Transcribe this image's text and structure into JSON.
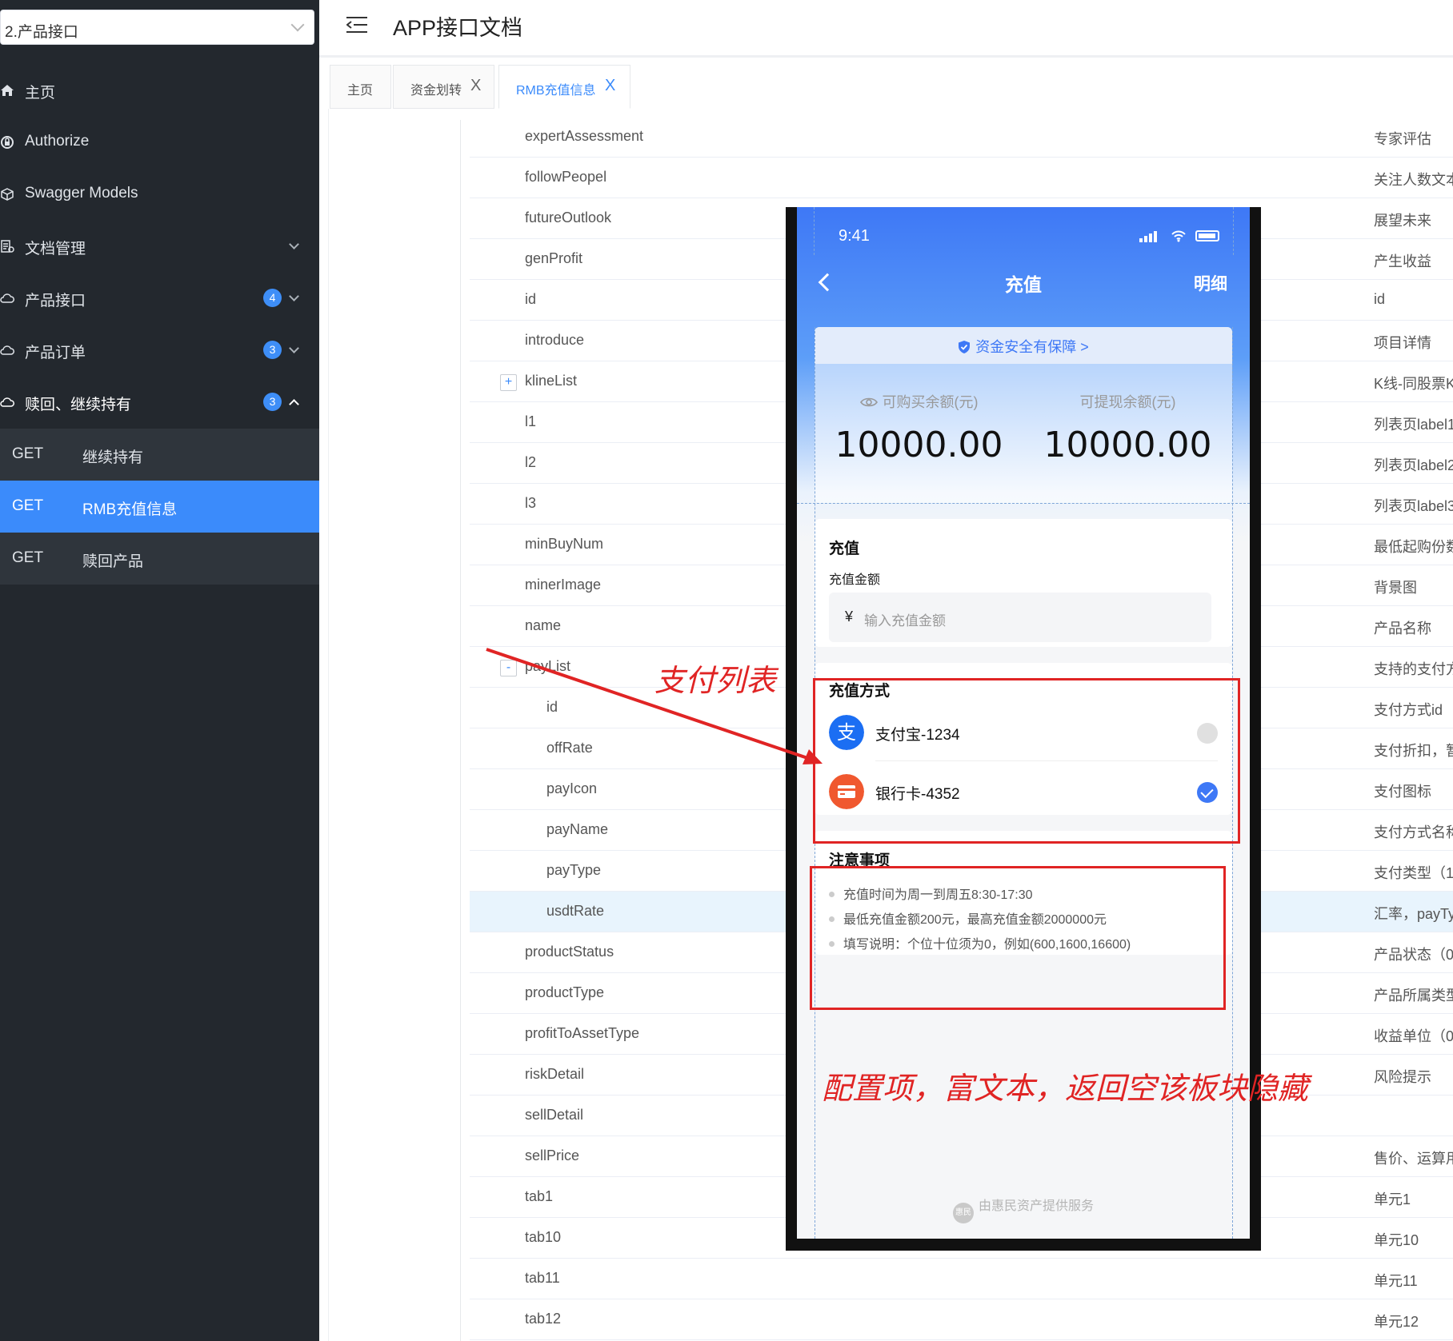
{
  "sidebar": {
    "project_select": "2.产品接口",
    "menu": [
      {
        "label": "主页"
      },
      {
        "label": "Authorize"
      },
      {
        "label": "Swagger Models"
      },
      {
        "label": "文档管理"
      },
      {
        "label": "产品接口",
        "badge": "4"
      },
      {
        "label": "产品订单",
        "badge": "3"
      },
      {
        "label": "赎回、继续持有",
        "badge": "3"
      }
    ],
    "submenu": [
      {
        "method": "GET",
        "name": "继续持有"
      },
      {
        "method": "GET",
        "name": "RMB充值信息"
      },
      {
        "method": "GET",
        "name": "赎回产品"
      }
    ]
  },
  "header": {
    "title": "APP接口文档"
  },
  "tabs": [
    {
      "label": "主页"
    },
    {
      "label": "资金划转",
      "close": "X"
    },
    {
      "label": "RMB充值信息",
      "close": "X"
    }
  ],
  "fields": [
    {
      "name": "expertAssessment",
      "desc": "专家评估"
    },
    {
      "name": "followPeopel",
      "desc": "关注人数文本"
    },
    {
      "name": "futureOutlook",
      "desc": "展望未来"
    },
    {
      "name": "genProfit",
      "desc": "产生收益"
    },
    {
      "name": "id",
      "desc": "id"
    },
    {
      "name": "introduce",
      "desc": "项目详情"
    },
    {
      "name": "klineList",
      "desc": "K线-同股票K",
      "expander": "+"
    },
    {
      "name": "l1",
      "desc": "列表页label1"
    },
    {
      "name": "l2",
      "desc": "列表页label2"
    },
    {
      "name": "l3",
      "desc": "列表页label3"
    },
    {
      "name": "minBuyNum",
      "desc": "最低起购份数"
    },
    {
      "name": "minerImage",
      "desc": "背景图"
    },
    {
      "name": "name",
      "desc": "产品名称"
    },
    {
      "name": "payList",
      "desc": "支持的支付方",
      "expander": "-"
    },
    {
      "name": "id",
      "desc": "支付方式id"
    },
    {
      "name": "offRate",
      "desc": "支付折扣，暂"
    },
    {
      "name": "payIcon",
      "desc": "支付图标"
    },
    {
      "name": "payName",
      "desc": "支付方式名称"
    },
    {
      "name": "payType",
      "desc": "支付类型（1"
    },
    {
      "name": "usdtRate",
      "desc": "汇率，payTy"
    },
    {
      "name": "productStatus",
      "desc": "产品状态（0"
    },
    {
      "name": "productType",
      "desc": "产品所属类型"
    },
    {
      "name": "profitToAssetType",
      "desc": "收益单位（0"
    },
    {
      "name": "riskDetail",
      "desc": "风险提示"
    },
    {
      "name": "sellDetail",
      "desc": ""
    },
    {
      "name": "sellPrice",
      "desc": "售价、运算用"
    },
    {
      "name": "tab1",
      "desc": "单元1"
    },
    {
      "name": "tab10",
      "desc": "单元10"
    },
    {
      "name": "tab11",
      "desc": "单元11"
    },
    {
      "name": "tab12",
      "desc": "单元12"
    }
  ],
  "phone": {
    "time": "9:41",
    "nav_title": "充值",
    "nav_right": "明细",
    "safe_text": "资金安全有保障 >",
    "balances": [
      {
        "label": "可购买余额(元)",
        "value": "10000.00"
      },
      {
        "label": "可提现余额(元)",
        "value": "10000.00"
      }
    ],
    "recharge": {
      "title": "充值",
      "amount_label": "充值金额",
      "currency": "¥",
      "placeholder": "输入充值金额"
    },
    "pay_methods": {
      "title": "充值方式",
      "items": [
        {
          "name": "支付宝-1234",
          "icon": "alipay-icon",
          "selected": false
        },
        {
          "name": "银行卡-4352",
          "icon": "bank-card-icon",
          "selected": true
        }
      ]
    },
    "notes": {
      "title": "注意事项",
      "items": [
        "充值时间为周一到周五8:30-17:30",
        "最低充值金额200元，最高充值金额2000000元",
        "填写说明：个位十位须为0，例如(600,1600,16600)"
      ]
    },
    "footer": "由惠民资产提供服务",
    "footer_logo": "惠民"
  },
  "annotations": {
    "paylist_label": "支付列表",
    "notes_label": "配置项，富文本，返回空该板块隐藏"
  },
  "colors": {
    "sidebar_bg": "#23282e",
    "accent": "#3b8bfb",
    "annotation_red": "#e02424"
  }
}
